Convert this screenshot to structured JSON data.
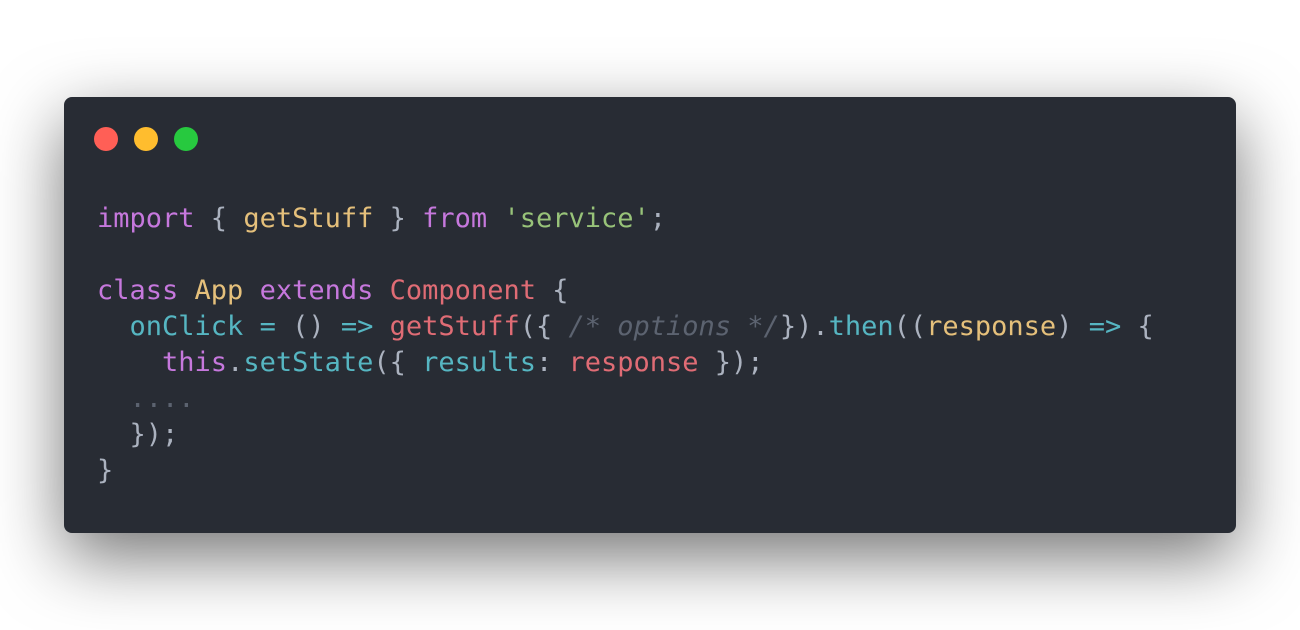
{
  "window": {
    "background": "#282c34",
    "controls": [
      {
        "name": "close",
        "color": "#ff5f56"
      },
      {
        "name": "minimize",
        "color": "#ffbd2e"
      },
      {
        "name": "zoom",
        "color": "#27c93f"
      }
    ]
  },
  "colors": {
    "default": "#abb2bf",
    "keyword": "#c678dd",
    "string": "#98c379",
    "class_name": "#e5c07b",
    "function": "#e06c75",
    "member": "#56b6c2",
    "operator": "#56b6c2",
    "variable": "#e06c75",
    "comment": "#5c6370"
  },
  "code": {
    "lines": [
      [
        {
          "text": "import",
          "type": "keyword"
        },
        {
          "text": " { ",
          "type": "default"
        },
        {
          "text": "getStuff",
          "type": "class_name"
        },
        {
          "text": " } ",
          "type": "default"
        },
        {
          "text": "from",
          "type": "keyword"
        },
        {
          "text": " ",
          "type": "default"
        },
        {
          "text": "'service'",
          "type": "string"
        },
        {
          "text": ";",
          "type": "default"
        }
      ],
      [],
      [
        {
          "text": "class",
          "type": "keyword"
        },
        {
          "text": " ",
          "type": "default"
        },
        {
          "text": "App",
          "type": "class_name"
        },
        {
          "text": " ",
          "type": "default"
        },
        {
          "text": "extends",
          "type": "keyword"
        },
        {
          "text": " ",
          "type": "default"
        },
        {
          "text": "Component",
          "type": "function"
        },
        {
          "text": " {",
          "type": "default"
        }
      ],
      [
        {
          "text": "  ",
          "type": "default"
        },
        {
          "text": "onClick",
          "type": "member"
        },
        {
          "text": " ",
          "type": "default"
        },
        {
          "text": "=",
          "type": "operator"
        },
        {
          "text": " () ",
          "type": "default"
        },
        {
          "text": "=>",
          "type": "operator"
        },
        {
          "text": " ",
          "type": "default"
        },
        {
          "text": "getStuff",
          "type": "function"
        },
        {
          "text": "({ ",
          "type": "default"
        },
        {
          "text": "/* options */",
          "type": "comment"
        },
        {
          "text": "}).",
          "type": "default"
        },
        {
          "text": "then",
          "type": "member"
        },
        {
          "text": "((",
          "type": "default"
        },
        {
          "text": "response",
          "type": "class_name"
        },
        {
          "text": ") ",
          "type": "default"
        },
        {
          "text": "=>",
          "type": "operator"
        },
        {
          "text": " {",
          "type": "default"
        }
      ],
      [
        {
          "text": "    ",
          "type": "default"
        },
        {
          "text": "this",
          "type": "keyword"
        },
        {
          "text": ".",
          "type": "default"
        },
        {
          "text": "setState",
          "type": "member"
        },
        {
          "text": "({ ",
          "type": "default"
        },
        {
          "text": "results",
          "type": "member"
        },
        {
          "text": ": ",
          "type": "default"
        },
        {
          "text": "response",
          "type": "variable"
        },
        {
          "text": " });",
          "type": "default"
        }
      ],
      [
        {
          "text": "  ....",
          "type": "comment"
        }
      ],
      [
        {
          "text": "  });",
          "type": "default"
        }
      ],
      [
        {
          "text": "}",
          "type": "default"
        }
      ]
    ]
  }
}
